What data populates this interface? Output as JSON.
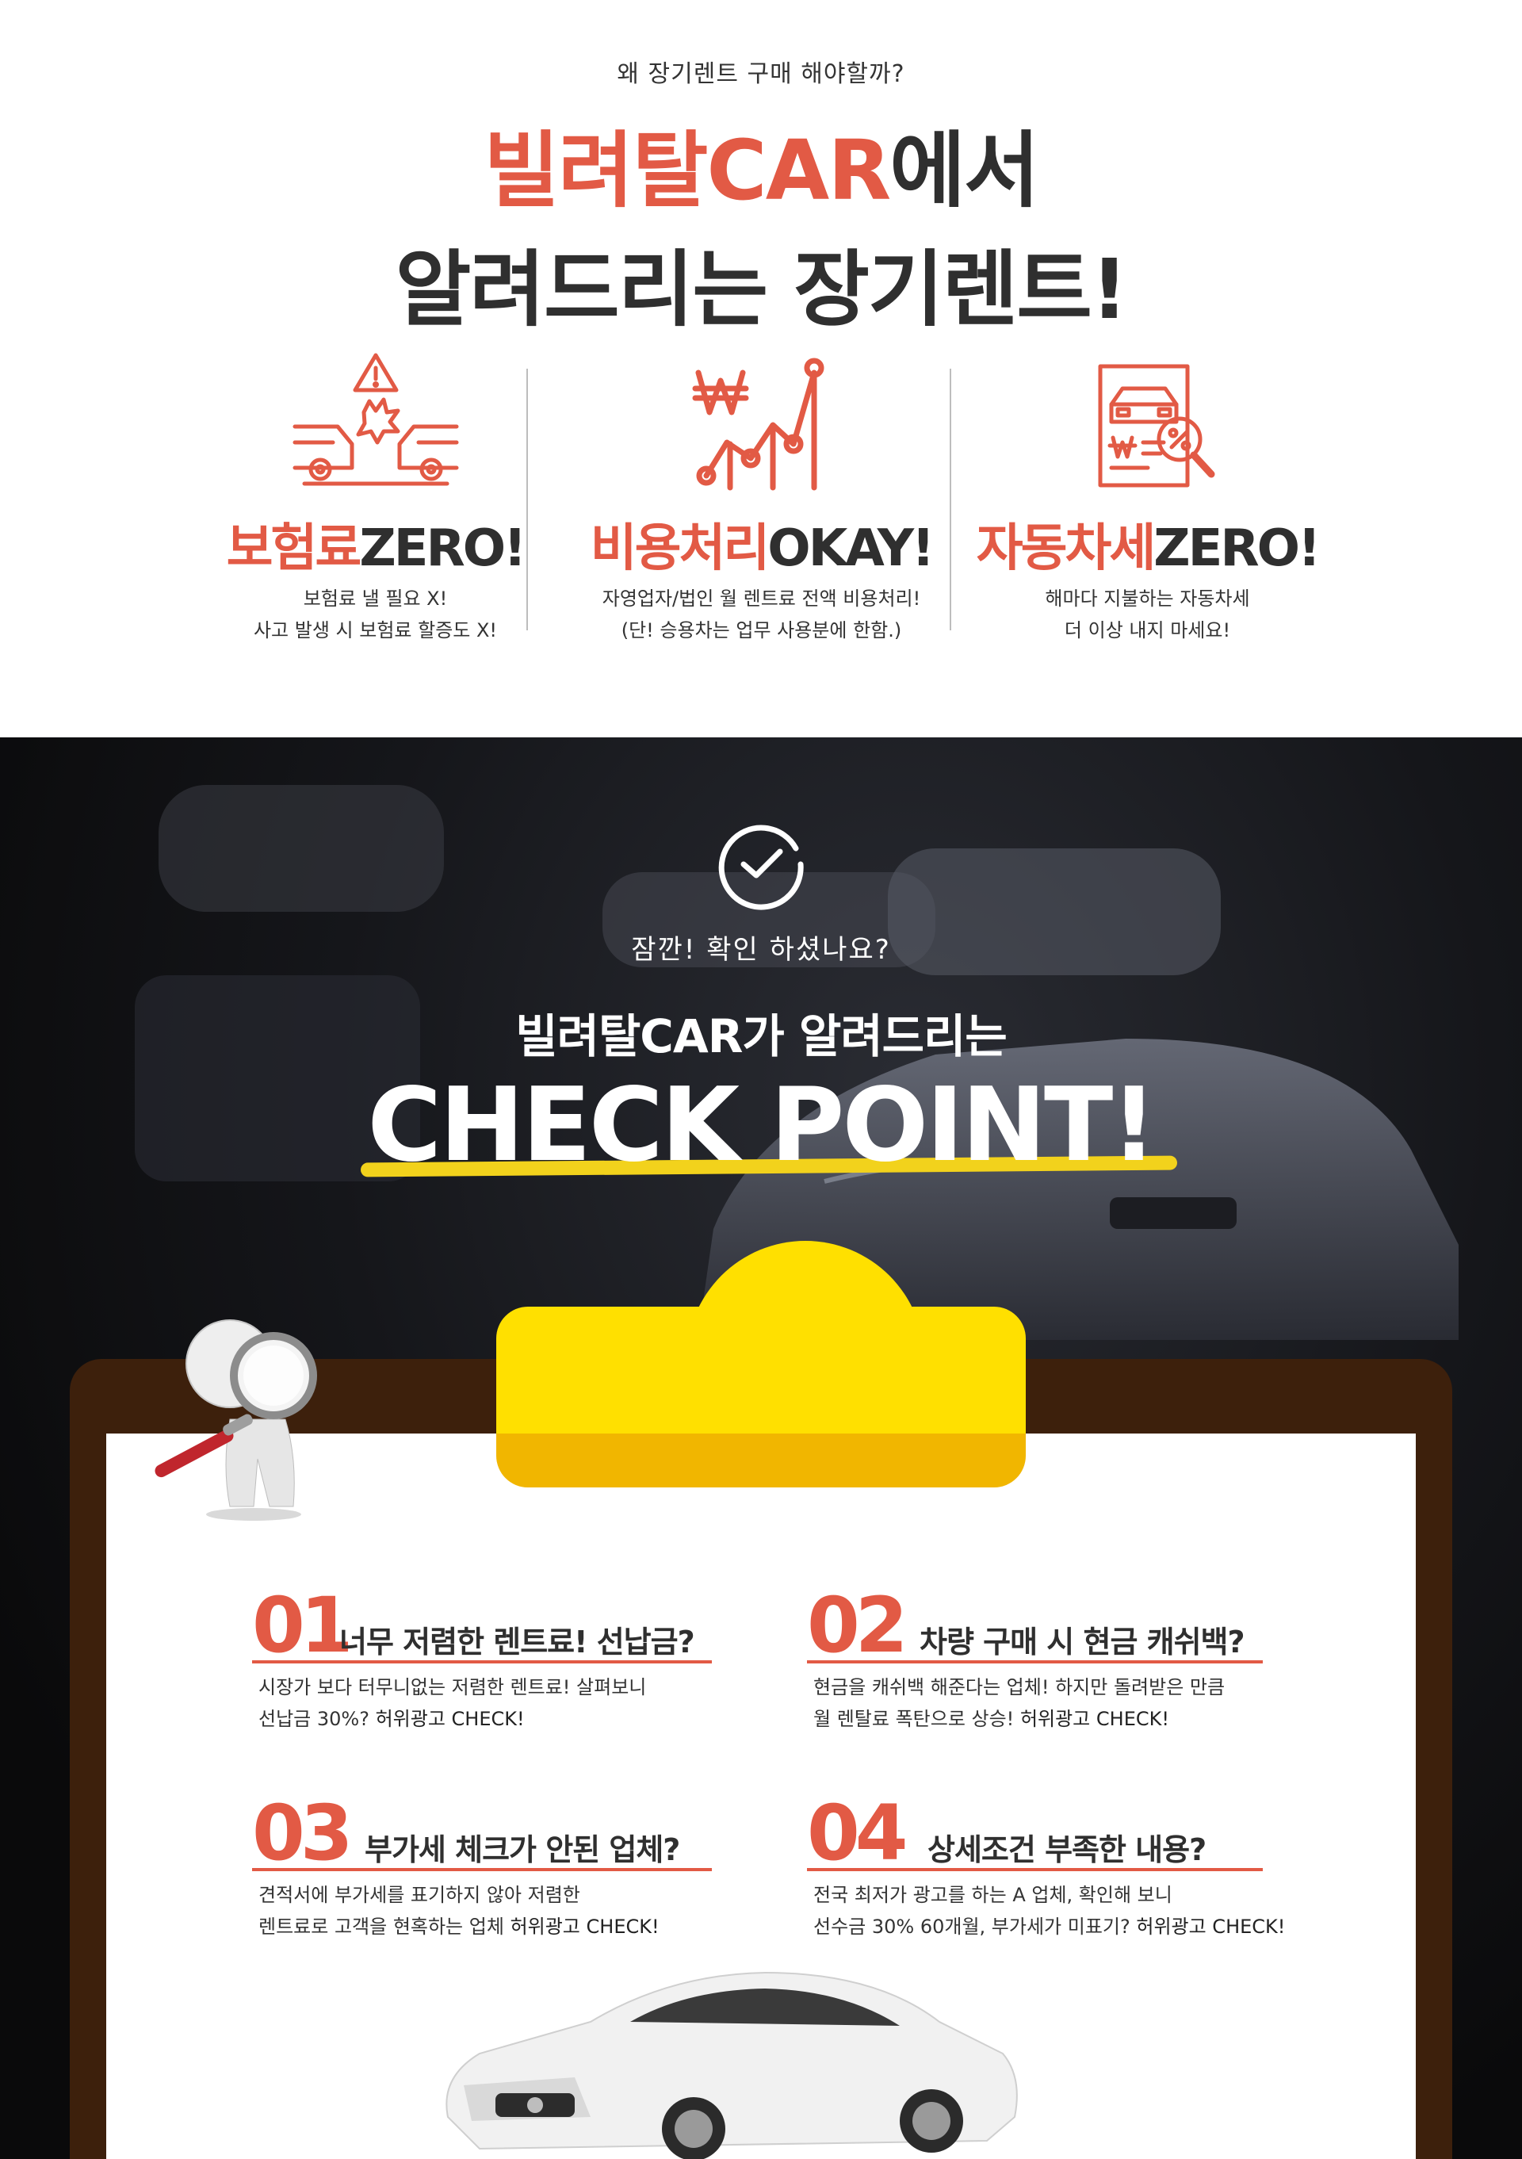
{
  "intro": {
    "kicker": "왜 장기렌트 구매 해야할까?",
    "headline_red": "빌려탈CAR",
    "headline_rest": "에서",
    "headline_line2": "알려드리는 장기렌트!"
  },
  "benefits": [
    {
      "icon": "car-crash-icon",
      "title_red": "보험료",
      "title_rest": "ZERO!",
      "desc_line1": "보험료 낼 필요 X!",
      "desc_line2": "사고 발생 시 보험료 할증도 X!"
    },
    {
      "icon": "won-chart-icon",
      "title_red": "비용처리",
      "title_rest": "OKAY!",
      "desc_line1": "자영업자/법인 월 렌트료 전액 비용처리!",
      "desc_line2": "(단! 승용차는 업무 사용분에 한함.)"
    },
    {
      "icon": "tax-document-icon",
      "title_red": "자동차세",
      "title_rest": "ZERO!",
      "desc_line1": "해마다 지불하는 자동차세",
      "desc_line2": "더 이상 내지 마세요!"
    }
  ],
  "check": {
    "icon": "check-circle-icon",
    "question": "잠깐! 확인 하셨나요?",
    "subhead": "빌려탈CAR가 알려드리는",
    "headline": "CHECK POINT!"
  },
  "points": [
    {
      "num": "01",
      "title": "너무 저렴한 렌트료! 선납금?",
      "line1": "시장가 보다 터무니없는 저렴한 렌트료! 살펴보니",
      "line2_pre": "선납금 30%? ",
      "line2_em": "허위광고 CHECK!"
    },
    {
      "num": "02",
      "title": "차량 구매 시 현금 캐쉬백?",
      "line1": "현금을 캐쉬백 해준다는 업체! 하지만 돌려받은 만큼",
      "line2_pre": "월 렌탈료 폭탄으로 상승! ",
      "line2_em": "허위광고 CHECK!"
    },
    {
      "num": "03",
      "title": "부가세 체크가 안된 업체?",
      "line1": "견적서에 부가세를 표기하지 않아 저렴한",
      "line2_pre": "렌트료로 고객을 현혹하는 업체 ",
      "line2_em": "허위광고 CHECK!"
    },
    {
      "num": "04",
      "title": "상세조건 부족한 내용?",
      "line1": "전국 최저가 광고를 하는 A 업체, 확인해 보니",
      "line2_pre": "선수금 30% 60개월, 부가세가 미표기? ",
      "line2_em": "허위광고 CHECK!"
    }
  ],
  "colors": {
    "accent": "#e25a45",
    "highlight": "#f2d21c",
    "clip": "#ffe000",
    "board": "#3d200c"
  }
}
